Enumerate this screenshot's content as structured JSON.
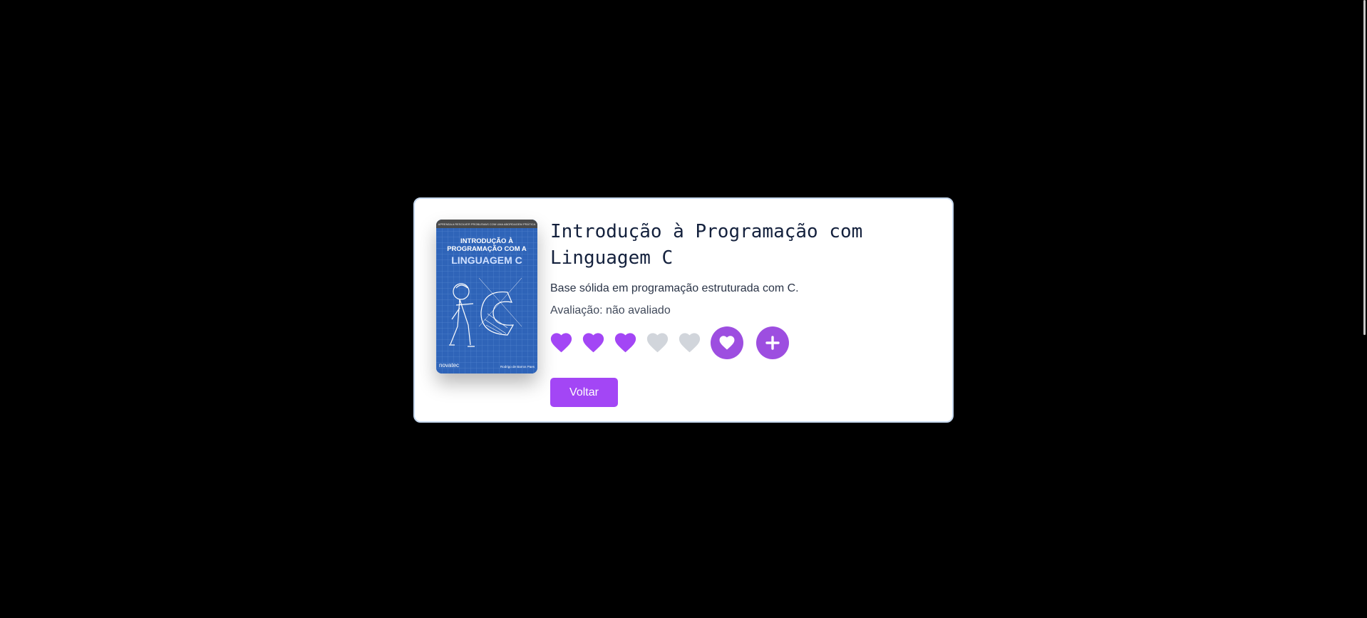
{
  "book": {
    "title_line1": "Introdução à Programação com",
    "title_line2": "Linguagem C",
    "description": "Base sólida em programação estruturada com C.",
    "rating_label": "Avaliação: não avaliado",
    "cover": {
      "top_banner": "APRENDA A RESOLVER PROBLEMAS COM UMA ABORDAGEM PRÁTICA",
      "title_line1": "INTRODUÇÃO À",
      "title_line2": "PROGRAMAÇÃO COM A",
      "title_line3": "LINGUAGEM C",
      "publisher": "novatec",
      "author": "Rodrigo de Barros Paes"
    }
  },
  "rating": {
    "value": 3,
    "max": 5,
    "filled_color": "#a346f5",
    "empty_color": "#d1d5db",
    "icons": [
      "heart-icon",
      "heart-icon",
      "heart-icon",
      "heart-icon",
      "heart-icon"
    ]
  },
  "actions": {
    "favorite_icon": "heart-icon",
    "add_icon": "plus-icon",
    "back_label": "Voltar"
  },
  "colors": {
    "accent": "#a346f5",
    "circle_button": "#9d4ee0",
    "card_border": "#c7d9ef",
    "background": "#000000"
  }
}
